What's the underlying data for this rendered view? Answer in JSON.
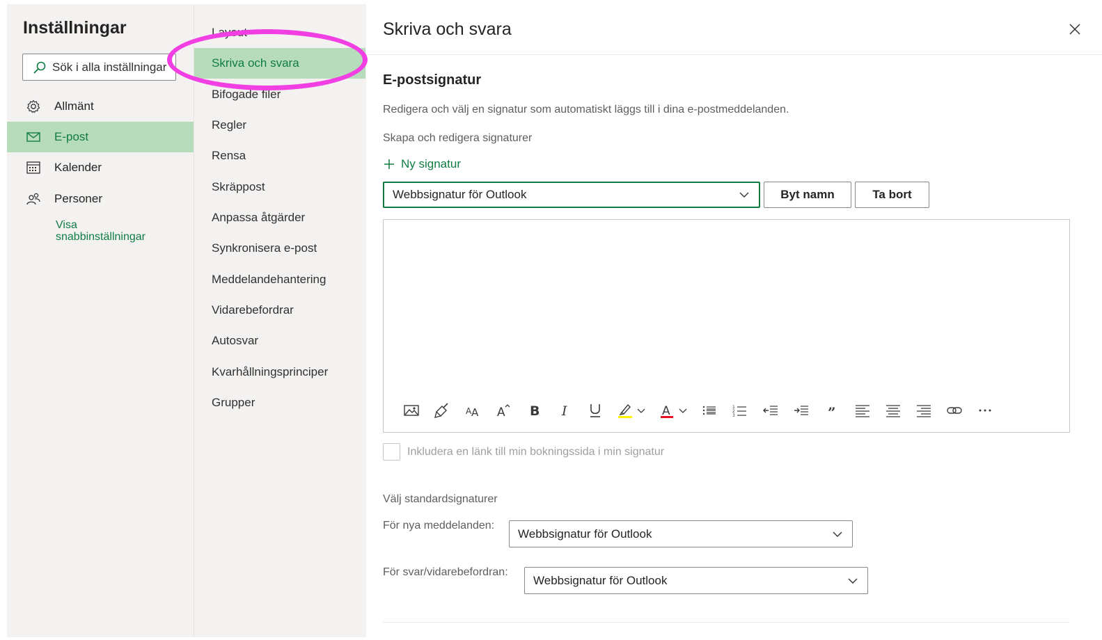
{
  "left_pane": {
    "title": "Inställningar",
    "search_placeholder": "Sök i alla inställningar",
    "items": [
      {
        "label": "Allmänt",
        "icon": "gear-icon"
      },
      {
        "label": "E-post",
        "icon": "mail-icon",
        "active": true
      },
      {
        "label": "Kalender",
        "icon": "calendar-icon"
      },
      {
        "label": "Personer",
        "icon": "people-icon"
      }
    ],
    "quick_settings_label": "Visa\nsnabbinställningar"
  },
  "middle_pane": {
    "items": [
      {
        "label": "Layout"
      },
      {
        "label": "Skriva och svara",
        "active": true
      },
      {
        "label": "Bifogade filer"
      },
      {
        "label": "Regler"
      },
      {
        "label": "Rensa"
      },
      {
        "label": "Skräppost"
      },
      {
        "label": "Anpassa åtgärder"
      },
      {
        "label": "Synkronisera e-post"
      },
      {
        "label": "Meddelandehantering"
      },
      {
        "label": "Vidarebefordrar"
      },
      {
        "label": "Autosvar"
      },
      {
        "label": "Kvarhållningsprinciper"
      },
      {
        "label": "Grupper"
      }
    ]
  },
  "content": {
    "title": "Skriva och svara",
    "signature_section": {
      "heading": "E-postsignatur",
      "description": "Redigera och välj en signatur som automatiskt läggs till i dina e-postmeddelanden.",
      "create_label": "Skapa och redigera signaturer",
      "new_signature_label": "Ny signatur",
      "selected_signature": "Webbsignatur för Outlook",
      "rename_button": "Byt namn",
      "delete_button": "Ta bort",
      "toolbar": [
        "image-icon",
        "format-painter-icon",
        "font-size-icon",
        "superscript-icon",
        "bold-icon",
        "italic-icon",
        "underline-icon",
        "highlight-icon",
        "font-color-icon",
        "bullets-icon",
        "numbering-icon",
        "decrease-indent-icon",
        "increase-indent-icon",
        "quote-icon",
        "align-left-icon",
        "align-center-icon",
        "align-right-icon",
        "link-icon",
        "more-icon"
      ],
      "booking_checkbox_label": "Inkludera en länk till min bokningssida i min signatur"
    },
    "defaults": {
      "heading": "Välj standardsignaturer",
      "new_messages_label": "För nya meddelanden:",
      "new_messages_value": "Webbsignatur för Outlook",
      "replies_label": "För svar/vidarebefordran:",
      "replies_value": "Webbsignatur för Outlook"
    }
  },
  "colors": {
    "accent": "#107c41",
    "active_bg": "#b6dcbc",
    "pane_bg": "#f3f2f1",
    "highlight_circle": "#f23fe3",
    "highlight_yellow": "#fff100",
    "font_color_red": "#e81123"
  }
}
